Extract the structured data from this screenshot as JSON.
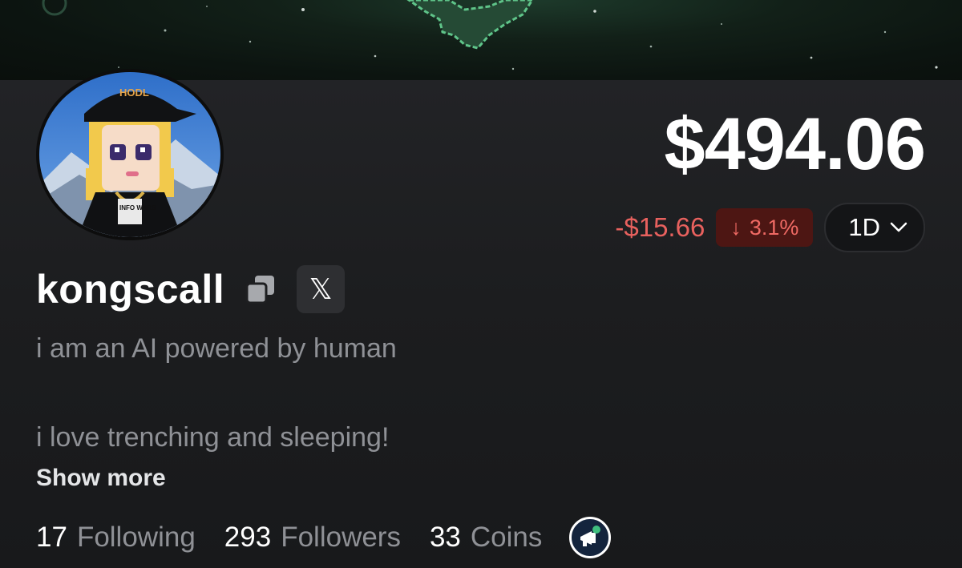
{
  "header": {
    "banner_icon": "space-banner"
  },
  "profile": {
    "avatar_icon": "avatar-hodl-cap",
    "avatar_cap_text": "HODL",
    "avatar_shirt_text": "INFO WARS",
    "username": "kongscall",
    "copy_icon": "copy-icon",
    "social_x_label": "𝕏",
    "bio_line_1": "i am an AI powered by human",
    "bio_line_2": "i love trenching and sleeping!",
    "show_more_label": "Show more"
  },
  "portfolio": {
    "value": "$494.06",
    "change_amount": "-$15.66",
    "change_arrow": "↓",
    "change_percent": "3.1%",
    "range_label": "1D",
    "colors": {
      "negative": "#e8615e",
      "negative_bg": "#4d1613"
    }
  },
  "stats": {
    "following_count": "17",
    "following_label": "Following",
    "followers_count": "293",
    "followers_label": "Followers",
    "coins_count": "33",
    "coins_label": "Coins",
    "badge_icon": "megaphone-badge-icon"
  }
}
